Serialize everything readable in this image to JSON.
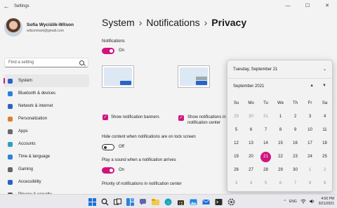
{
  "window": {
    "title": "Settings",
    "back_glyph": "←",
    "minimize": "—",
    "maximize": "☐",
    "close": "✕"
  },
  "user": {
    "name": "Sofia Wyciślik-Wilson",
    "email": "wilsonmark@gmail.com"
  },
  "search": {
    "placeholder": "Find a setting"
  },
  "nav": [
    {
      "label": "System",
      "icon": "system-icon",
      "color": "#2a63c5",
      "selected": true
    },
    {
      "label": "Bluetooth & devices",
      "icon": "bluetooth-icon",
      "color": "#2a83d9"
    },
    {
      "label": "Network & internet",
      "icon": "network-icon",
      "color": "#2a63c5"
    },
    {
      "label": "Personalization",
      "icon": "brush-icon",
      "color": "#d9822a"
    },
    {
      "label": "Apps",
      "icon": "apps-icon",
      "color": "#6a6a6a"
    },
    {
      "label": "Accounts",
      "icon": "accounts-icon",
      "color": "#2aa0c5"
    },
    {
      "label": "Time & language",
      "icon": "globe-icon",
      "color": "#2a83d9"
    },
    {
      "label": "Gaming",
      "icon": "gaming-icon",
      "color": "#666"
    },
    {
      "label": "Accessibility",
      "icon": "accessibility-icon",
      "color": "#2a63c5"
    },
    {
      "label": "Privacy & security",
      "icon": "shield-icon",
      "color": "#555"
    }
  ],
  "breadcrumb": {
    "first": "System",
    "second": "Notifications",
    "current": "Privacy",
    "sep": "›"
  },
  "notifications": {
    "label": "Notifications",
    "state": "On"
  },
  "checks": {
    "banners": "Show notification banners",
    "center_line1": "Show notifications in",
    "center_line2": "notification center",
    "checkmark": "✓"
  },
  "lock_screen": {
    "label": "Hide content when notifications are on lock screen",
    "state": "Off"
  },
  "sound": {
    "label": "Play a sound when a notification arrives",
    "state": "On"
  },
  "priority": {
    "label": "Priority of notifications in notification center"
  },
  "calendar": {
    "date_header": "Tuesday, September 21",
    "month": "September 2021",
    "collapse_glyph": "⌄",
    "up_glyph": "▲",
    "down_glyph": "▼",
    "weekdays": [
      "Su",
      "Mo",
      "Tu",
      "We",
      "Th",
      "Fr",
      "Sa"
    ],
    "weeks": [
      [
        "29",
        "30",
        "31",
        "1",
        "2",
        "3",
        "4"
      ],
      [
        "5",
        "6",
        "7",
        "8",
        "9",
        "10",
        "11"
      ],
      [
        "12",
        "13",
        "14",
        "15",
        "16",
        "17",
        "18"
      ],
      [
        "19",
        "20",
        "21",
        "22",
        "23",
        "24",
        "25"
      ],
      [
        "26",
        "27",
        "28",
        "29",
        "30",
        "1",
        "2"
      ],
      [
        "3",
        "4",
        "5",
        "6",
        "7",
        "8",
        "9"
      ]
    ],
    "today": "21",
    "accent": "#d0147e"
  },
  "taskbar": {
    "language": "ENG",
    "time": "4:50 PM",
    "date": "9/21/2021",
    "chevron": "^"
  }
}
